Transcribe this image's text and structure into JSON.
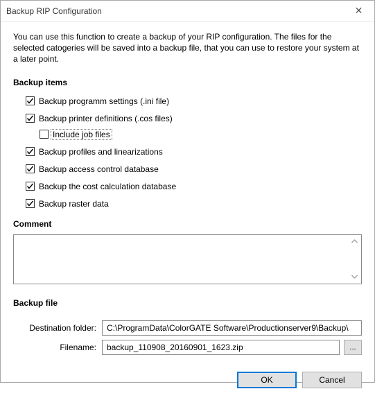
{
  "window": {
    "title": "Backup RIP Configuration"
  },
  "intro": {
    "text": "You can use this function to create a backup of your RIP configuration. The files for the selected catogeries will be saved into a backup file, that you can use to restore your system at a later point."
  },
  "sections": {
    "backup_items_head": "Backup items",
    "comment_head": "Comment",
    "backup_file_head": "Backup file"
  },
  "checks": {
    "program_settings": {
      "label": "Backup programm settings (.ini file)",
      "checked": true
    },
    "printer_defs": {
      "label": "Backup printer definitions (.cos files)",
      "checked": true
    },
    "include_job": {
      "label": "Include job files",
      "checked": false
    },
    "profiles": {
      "label": "Backup profiles and linearizations",
      "checked": true
    },
    "access_ctrl": {
      "label": "Backup access control database",
      "checked": true
    },
    "cost_calc": {
      "label": "Backup the cost calculation database",
      "checked": true
    },
    "raster": {
      "label": "Backup raster data",
      "checked": true
    }
  },
  "fields": {
    "dest_label": "Destination folder:",
    "dest_value": "C:\\ProgramData\\ColorGATE Software\\Productionserver9\\Backup\\",
    "filename_label": "Filename:",
    "filename_value": "backup_110908_20160901_1623.zip",
    "browse_label": "..."
  },
  "buttons": {
    "ok": "OK",
    "cancel": "Cancel"
  }
}
